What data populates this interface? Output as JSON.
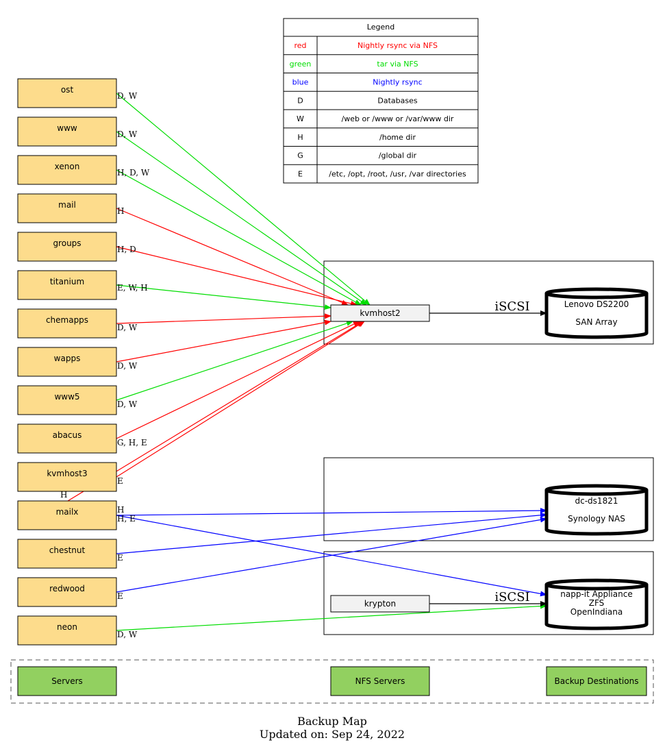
{
  "legend": {
    "title": "Legend",
    "rows": [
      {
        "key": "red",
        "desc": "Nightly rsync via NFS",
        "color": "#ff0000"
      },
      {
        "key": "green",
        "desc": "tar via NFS",
        "color": "#00dd00"
      },
      {
        "key": "blue",
        "desc": "Nightly rsync",
        "color": "#0000ff"
      },
      {
        "key": "D",
        "desc": "Databases",
        "color": "#000000"
      },
      {
        "key": "W",
        "desc": "/web or /www or /var/www dir",
        "color": "#000000"
      },
      {
        "key": "H",
        "desc": "/home dir",
        "color": "#000000"
      },
      {
        "key": "G",
        "desc": "/global dir",
        "color": "#000000"
      },
      {
        "key": "E",
        "desc": "/etc, /opt, /root, /usr, /var directories",
        "color": "#000000"
      }
    ]
  },
  "colors": {
    "server_fill": "#fddc8c",
    "nfs_fill": "#f2f2f2",
    "category_fill": "#92d060",
    "red": "#ff0000",
    "green": "#00dd00",
    "blue": "#0000ff"
  },
  "servers": [
    {
      "id": "ost",
      "label": "ost"
    },
    {
      "id": "www",
      "label": "www"
    },
    {
      "id": "xenon",
      "label": "xenon"
    },
    {
      "id": "mail",
      "label": "mail"
    },
    {
      "id": "groups",
      "label": "groups"
    },
    {
      "id": "titanium",
      "label": "titanium"
    },
    {
      "id": "chemapps",
      "label": "chemapps"
    },
    {
      "id": "wapps",
      "label": "wapps"
    },
    {
      "id": "www5",
      "label": "www5"
    },
    {
      "id": "abacus",
      "label": "abacus"
    },
    {
      "id": "kvmhost3",
      "label": "kvmhost3"
    },
    {
      "id": "mailx",
      "label": "mailx"
    },
    {
      "id": "chestnut",
      "label": "chestnut"
    },
    {
      "id": "redwood",
      "label": "redwood"
    },
    {
      "id": "neon",
      "label": "neon"
    }
  ],
  "nfs_servers": [
    {
      "id": "kvmhost2",
      "label": "kvmhost2"
    },
    {
      "id": "krypton",
      "label": "krypton"
    }
  ],
  "destinations": [
    {
      "id": "lenovo",
      "lines": [
        "Lenovo DS2200",
        "SAN Array"
      ]
    },
    {
      "id": "synology",
      "lines": [
        "dc-ds1821",
        "Synology NAS"
      ]
    },
    {
      "id": "napp",
      "lines": [
        "napp-it Appliance",
        "ZFS",
        "OpenIndiana"
      ]
    }
  ],
  "edges": [
    {
      "from": "ost",
      "to": "kvmhost2",
      "color": "green",
      "label": "D, W"
    },
    {
      "from": "www",
      "to": "kvmhost2",
      "color": "green",
      "label": "D, W"
    },
    {
      "from": "xenon",
      "to": "kvmhost2",
      "color": "green",
      "label": "H, D, W"
    },
    {
      "from": "mail",
      "to": "kvmhost2",
      "color": "red",
      "label": "H"
    },
    {
      "from": "groups",
      "to": "kvmhost2",
      "color": "red",
      "label": "H, D"
    },
    {
      "from": "titanium",
      "to": "kvmhost2",
      "color": "green",
      "label": "E, W, H"
    },
    {
      "from": "chemapps",
      "to": "kvmhost2",
      "color": "red",
      "label": "D, W"
    },
    {
      "from": "wapps",
      "to": "kvmhost2",
      "color": "red",
      "label": "D, W"
    },
    {
      "from": "www5",
      "to": "kvmhost2",
      "color": "green",
      "label": "D, W"
    },
    {
      "from": "abacus",
      "to": "kvmhost2",
      "color": "red",
      "label": "G, H, E"
    },
    {
      "from": "kvmhost3",
      "to": "kvmhost2",
      "color": "red",
      "label": "E"
    },
    {
      "from": "mailx",
      "to": "kvmhost2",
      "color": "red",
      "label": "H"
    },
    {
      "from": "mailx",
      "to": "synology",
      "color": "blue",
      "label": "H"
    },
    {
      "from": "mailx",
      "to": "napp",
      "color": "blue",
      "label": "H, E"
    },
    {
      "from": "chestnut",
      "to": "synology",
      "color": "blue",
      "label": "E"
    },
    {
      "from": "redwood",
      "to": "synology",
      "color": "blue",
      "label": "E"
    },
    {
      "from": "neon",
      "to": "napp",
      "color": "green",
      "label": "D, W"
    },
    {
      "from": "kvmhost2",
      "to": "lenovo",
      "color": "black",
      "label": "iSCSI"
    },
    {
      "from": "krypton",
      "to": "napp",
      "color": "black",
      "label": "iSCSI"
    }
  ],
  "categories": [
    {
      "label": "Servers"
    },
    {
      "label": "NFS Servers"
    },
    {
      "label": "Backup Destinations"
    }
  ],
  "footer": {
    "title": "Backup Map",
    "updated": "Updated on: Sep 24, 2022"
  }
}
